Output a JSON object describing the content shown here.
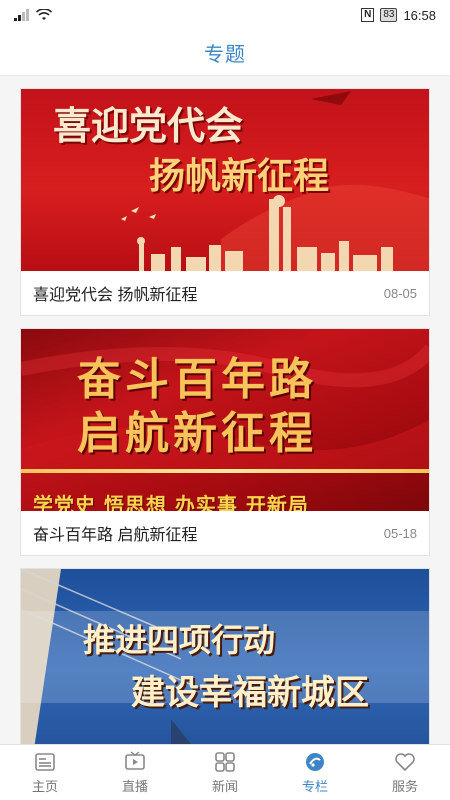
{
  "status_bar": {
    "left_icons": [
      "signal-icon",
      "wifi-icon"
    ],
    "nfc": "N",
    "battery": "83",
    "time": "16:58"
  },
  "header": {
    "title": "专题"
  },
  "cards": [
    {
      "banner_lines": [
        "喜迎党代会",
        "扬帆新征程"
      ],
      "title": "喜迎党代会 扬帆新征程",
      "date": "08-05"
    },
    {
      "banner_lines": [
        "奋斗百年路",
        "启航新征程",
        "学党史 悟思想 办实事 开新局"
      ],
      "title": "奋斗百年路 启航新征程",
      "date": "05-18"
    },
    {
      "banner_lines": [
        "推进四项行动",
        "建设幸福新城区"
      ],
      "title": "",
      "date": ""
    }
  ],
  "tabs": [
    {
      "label": "主页",
      "icon": "home-icon"
    },
    {
      "label": "直播",
      "icon": "live-icon"
    },
    {
      "label": "新闻",
      "icon": "news-icon"
    },
    {
      "label": "专栏",
      "icon": "column-icon"
    },
    {
      "label": "服务",
      "icon": "heart-icon"
    }
  ],
  "colors": {
    "accent": "#3d86c6",
    "banner_red": "#c2121a",
    "banner_blue": "#2f67b6"
  }
}
